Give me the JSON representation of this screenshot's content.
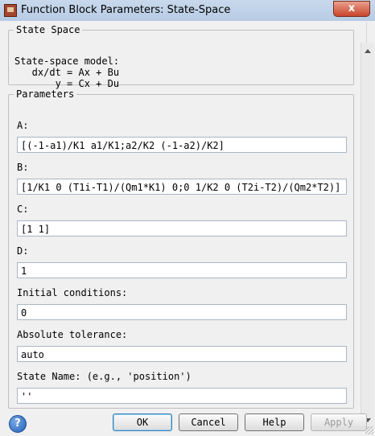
{
  "window": {
    "title": "Function Block Parameters: State-Space",
    "close_label": "x"
  },
  "description": {
    "legend": "State Space",
    "lines": [
      "State-space model:",
      "   dx/dt = Ax + Bu",
      "       y = Cx + Du"
    ]
  },
  "parameters": {
    "legend": "Parameters",
    "fields": [
      {
        "label": "A:",
        "value": "[(-1-a1)/K1 a1/K1;a2/K2 (-1-a2)/K2]"
      },
      {
        "label": "B:",
        "value": "[1/K1 0 (T1i-T1)/(Qm1*K1) 0;0 1/K2 0 (T2i-T2)/(Qm2*T2)]"
      },
      {
        "label": "C:",
        "value": "[1 1]"
      },
      {
        "label": "D:",
        "value": "1"
      },
      {
        "label": "Initial conditions:",
        "value": "0"
      },
      {
        "label": "Absolute tolerance:",
        "value": "auto"
      },
      {
        "label": "State Name: (e.g., 'position')",
        "value": "''"
      }
    ]
  },
  "buttons": {
    "help_icon": "?",
    "ok": "OK",
    "cancel": "Cancel",
    "help": "Help",
    "apply": "Apply"
  }
}
